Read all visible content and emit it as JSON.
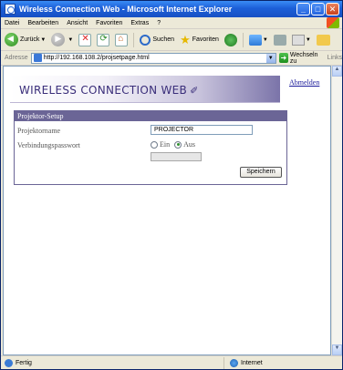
{
  "window": {
    "title": "Wireless Connection Web - Microsoft Internet Explorer",
    "minimize": "_",
    "maximize": "□",
    "close": "✕"
  },
  "menu": {
    "items": [
      "Datei",
      "Bearbeiten",
      "Ansicht",
      "Favoriten",
      "Extras",
      "?"
    ]
  },
  "toolbar": {
    "back_label": "Zurück",
    "search_label": "Suchen",
    "favorites_label": "Favoriten"
  },
  "address": {
    "label": "Adresse",
    "url": "http://192.168.108.2/projsetpage.html",
    "go_label": "Wechseln zu",
    "links_label": "Links"
  },
  "page": {
    "brand": "WIRELESS CONNECTION WEB",
    "logout_label": "Abmelden",
    "panel_title": "Projektor-Setup",
    "projector_name_label": "Projektorname",
    "projector_name_value": "PROJECTOR",
    "password_label": "Verbindungspasswort",
    "radio_on_label": "Ein",
    "radio_off_label": "Aus",
    "password_enabled": false,
    "save_label": "Speichern"
  },
  "status": {
    "left_text": "Fertig",
    "zone_text": "Internet"
  },
  "colors": {
    "titlebar": "#1c5fd8",
    "panel_header": "#6b6596",
    "brand_text": "#3a2e7a",
    "link": "#1a1a9a"
  }
}
